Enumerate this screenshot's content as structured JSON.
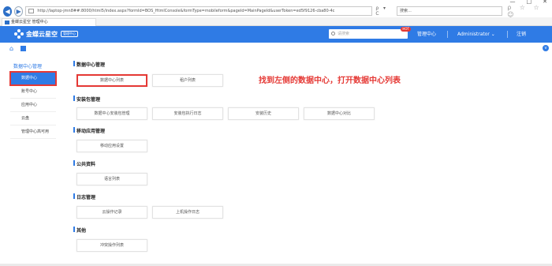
{
  "browser": {
    "address_url": "http://laptop-jmn8##:8000/html5/index.aspx?formId=BOS_HtmlConsole&formType=mobileform&pageId=MainPageId&userToken=ed5f9126-cba80-4c",
    "address_tools": "ρ ▾ C",
    "search_placeholder": "搜索...",
    "search_tools": "ρ ☆ ☆ ☺",
    "tab_title": "金蝶云星空 管理中心",
    "window_controls": [
      "—",
      "□",
      "✕"
    ]
  },
  "header": {
    "logo_text": "金蝶云星空",
    "logo_badge": "管理中心",
    "search_placeholder": "请搜索",
    "search_badge": "HOT",
    "nav_manage": "管理中心",
    "nav_user": "Administrator ⌄",
    "nav_logout": "注销"
  },
  "subbar": {
    "home_icon": "⌂",
    "expand_icon": "v"
  },
  "sidebar": {
    "title": "数据中心管理",
    "items": [
      {
        "label": "数据中心"
      },
      {
        "label": "账号中心"
      },
      {
        "label": "应用中心"
      },
      {
        "label": "云盘"
      },
      {
        "label": "管理中心高可用"
      }
    ]
  },
  "sections": {
    "dc": {
      "title": "数据中心管理",
      "cards": [
        "数据中心列表",
        "租户列表"
      ]
    },
    "pkg": {
      "title": "安装包管理",
      "cards": [
        "数据中心安装包管理",
        "安装包执行日志",
        "安装历史",
        "数据中心对比"
      ]
    },
    "mobile": {
      "title": "移动应用管理",
      "cards": [
        "移动应用设置"
      ]
    },
    "common": {
      "title": "公共资料",
      "cards": [
        "语言列表"
      ]
    },
    "log": {
      "title": "日志管理",
      "cards": [
        "云操作记录",
        "上机操作日志"
      ]
    },
    "other": {
      "title": "其他",
      "cards": [
        "冲突操作列表"
      ]
    }
  },
  "annotation": "找到左侧的数据中心，打开数据中心列表",
  "colors": {
    "brand": "#2f7be5",
    "highlight": "#e53935"
  }
}
